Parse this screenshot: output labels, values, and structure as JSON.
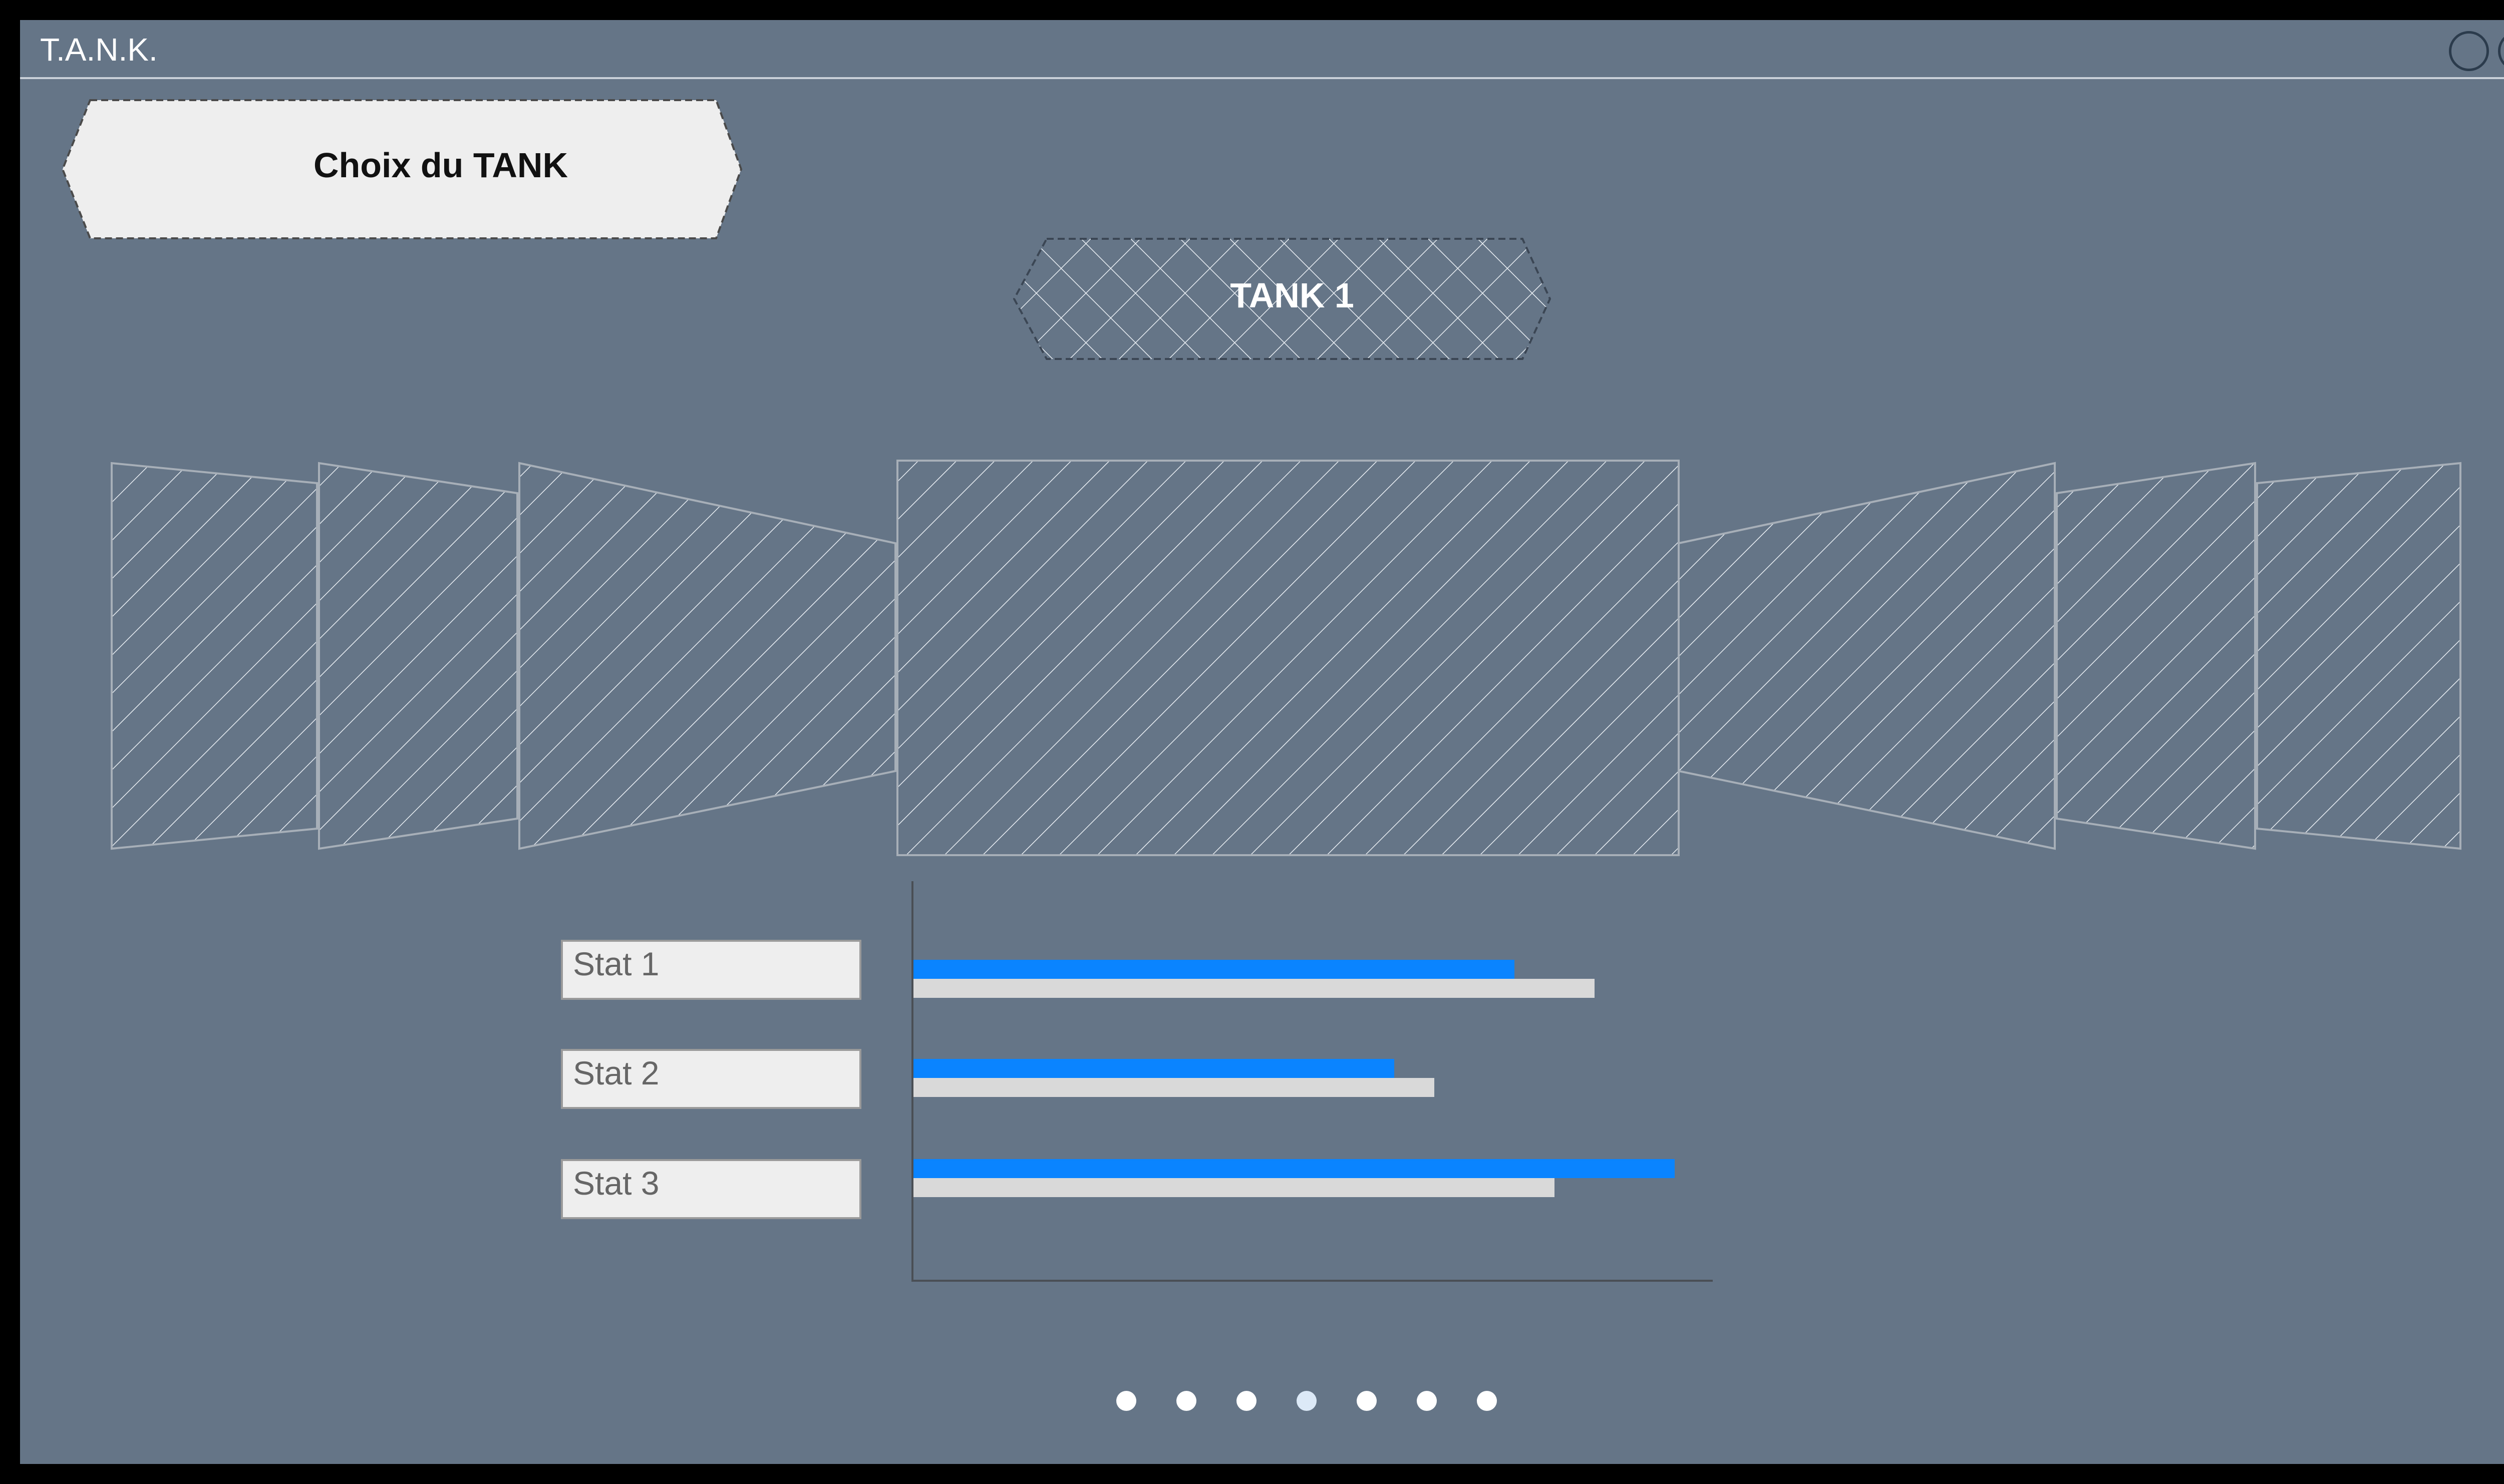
{
  "window": {
    "title": "T.A.N.K.",
    "controls": [
      "minimize-icon",
      "maximize-icon",
      "close-icon"
    ]
  },
  "header": {
    "label": "Choix du TANK"
  },
  "carousel": {
    "selected_label": "TANK 1",
    "item_count": 7,
    "selected_index": 3
  },
  "stats": {
    "labels": [
      "Stat 1",
      "Stat 2",
      "Stat 3"
    ],
    "primary_color": "#0a84ff",
    "secondary_color": "#d9d9d9"
  },
  "chart_data": {
    "type": "bar",
    "orientation": "horizontal",
    "categories": [
      "Stat 1",
      "Stat 2",
      "Stat 3"
    ],
    "series": [
      {
        "values": [
          75,
          60,
          95
        ]
      },
      {
        "values": [
          85,
          65,
          80
        ]
      }
    ],
    "xlim": [
      0,
      100
    ]
  },
  "pagination": {
    "count": 7,
    "active_index": 3,
    "active_color": "#dce9f7"
  },
  "help": {
    "label": "?"
  }
}
